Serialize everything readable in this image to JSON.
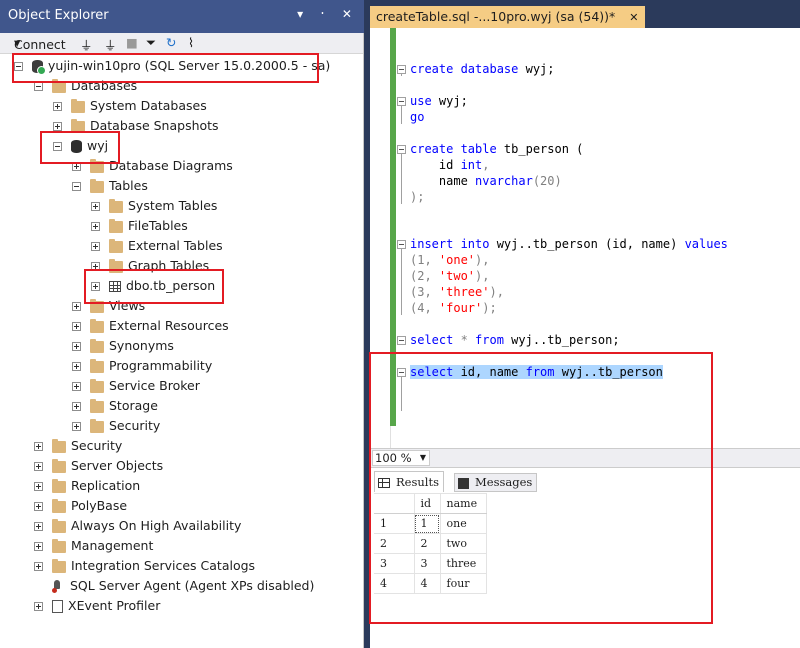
{
  "object_explorer": {
    "title": "Object Explorer",
    "title_buttons": "▾ ᛫ ✕",
    "toolbar": {
      "connect_label": "Connect"
    },
    "server": {
      "label": "yujin-win10pro (SQL Server 15.0.2000.5 - sa)"
    },
    "nodes": {
      "databases": "Databases",
      "system_databases": "System Databases",
      "database_snapshots": "Database Snapshots",
      "wyj": "wyj",
      "database_diagrams": "Database Diagrams",
      "tables": "Tables",
      "system_tables": "System Tables",
      "file_tables": "FileTables",
      "external_tables": "External Tables",
      "graph_tables": "Graph Tables",
      "dbo_tb_person": "dbo.tb_person",
      "views": "Views",
      "external_resources": "External Resources",
      "synonyms": "Synonyms",
      "programmability": "Programmability",
      "service_broker": "Service Broker",
      "storage": "Storage",
      "db_security": "Security",
      "security": "Security",
      "server_objects": "Server Objects",
      "replication": "Replication",
      "polybase": "PolyBase",
      "always_on": "Always On High Availability",
      "management": "Management",
      "integration_services": "Integration Services Catalogs",
      "sql_agent": "SQL Server Agent (Agent XPs disabled)",
      "xevent_profiler": "XEvent Profiler"
    }
  },
  "editor": {
    "tab_label": "createTable.sql -...10pro.wyj (sa (54))*",
    "tab_close": "✕",
    "zoom": "100 %"
  },
  "code": {
    "l1_kw": "create database",
    "l1_rest": " wyj;",
    "l2_kw": "use",
    "l2_rest": " wyj;",
    "l3": "go",
    "l4_kw": "create table",
    "l4_rest": " tb_person (",
    "l5_a": "    id ",
    "l5_kw": "int",
    "l5_c": ",",
    "l6_a": "    name ",
    "l6_kw": "nvarchar",
    "l6_c": "(20)",
    "l7": ");",
    "l8_kw": "insert into",
    "l8_mid": " wyj..tb_person (id, name) ",
    "l8_kw2": "values",
    "l9_a": "(1, ",
    "l9_s": "'one'",
    "l9_c": "),",
    "l10_a": "(2, ",
    "l10_s": "'two'",
    "l10_c": "),",
    "l11_a": "(3, ",
    "l11_s": "'three'",
    "l11_c": "),",
    "l12_a": "(4, ",
    "l12_s": "'four'",
    "l12_c": ");",
    "l13_kw": "select",
    "l13_star": " * ",
    "l13_kw2": "from",
    "l13_rest": " wyj..tb_person;",
    "l14_kw": "select",
    "l14_a": " id, name ",
    "l14_kw2": "from",
    "l14_rest": " wyj..tb_person"
  },
  "results": {
    "tab_results": "Results",
    "tab_messages": "Messages",
    "columns": [
      "id",
      "name"
    ],
    "rows": [
      {
        "n": "1",
        "id": "1",
        "name": "one"
      },
      {
        "n": "2",
        "id": "2",
        "name": "two"
      },
      {
        "n": "3",
        "id": "3",
        "name": "three"
      },
      {
        "n": "4",
        "id": "4",
        "name": "four"
      }
    ]
  }
}
